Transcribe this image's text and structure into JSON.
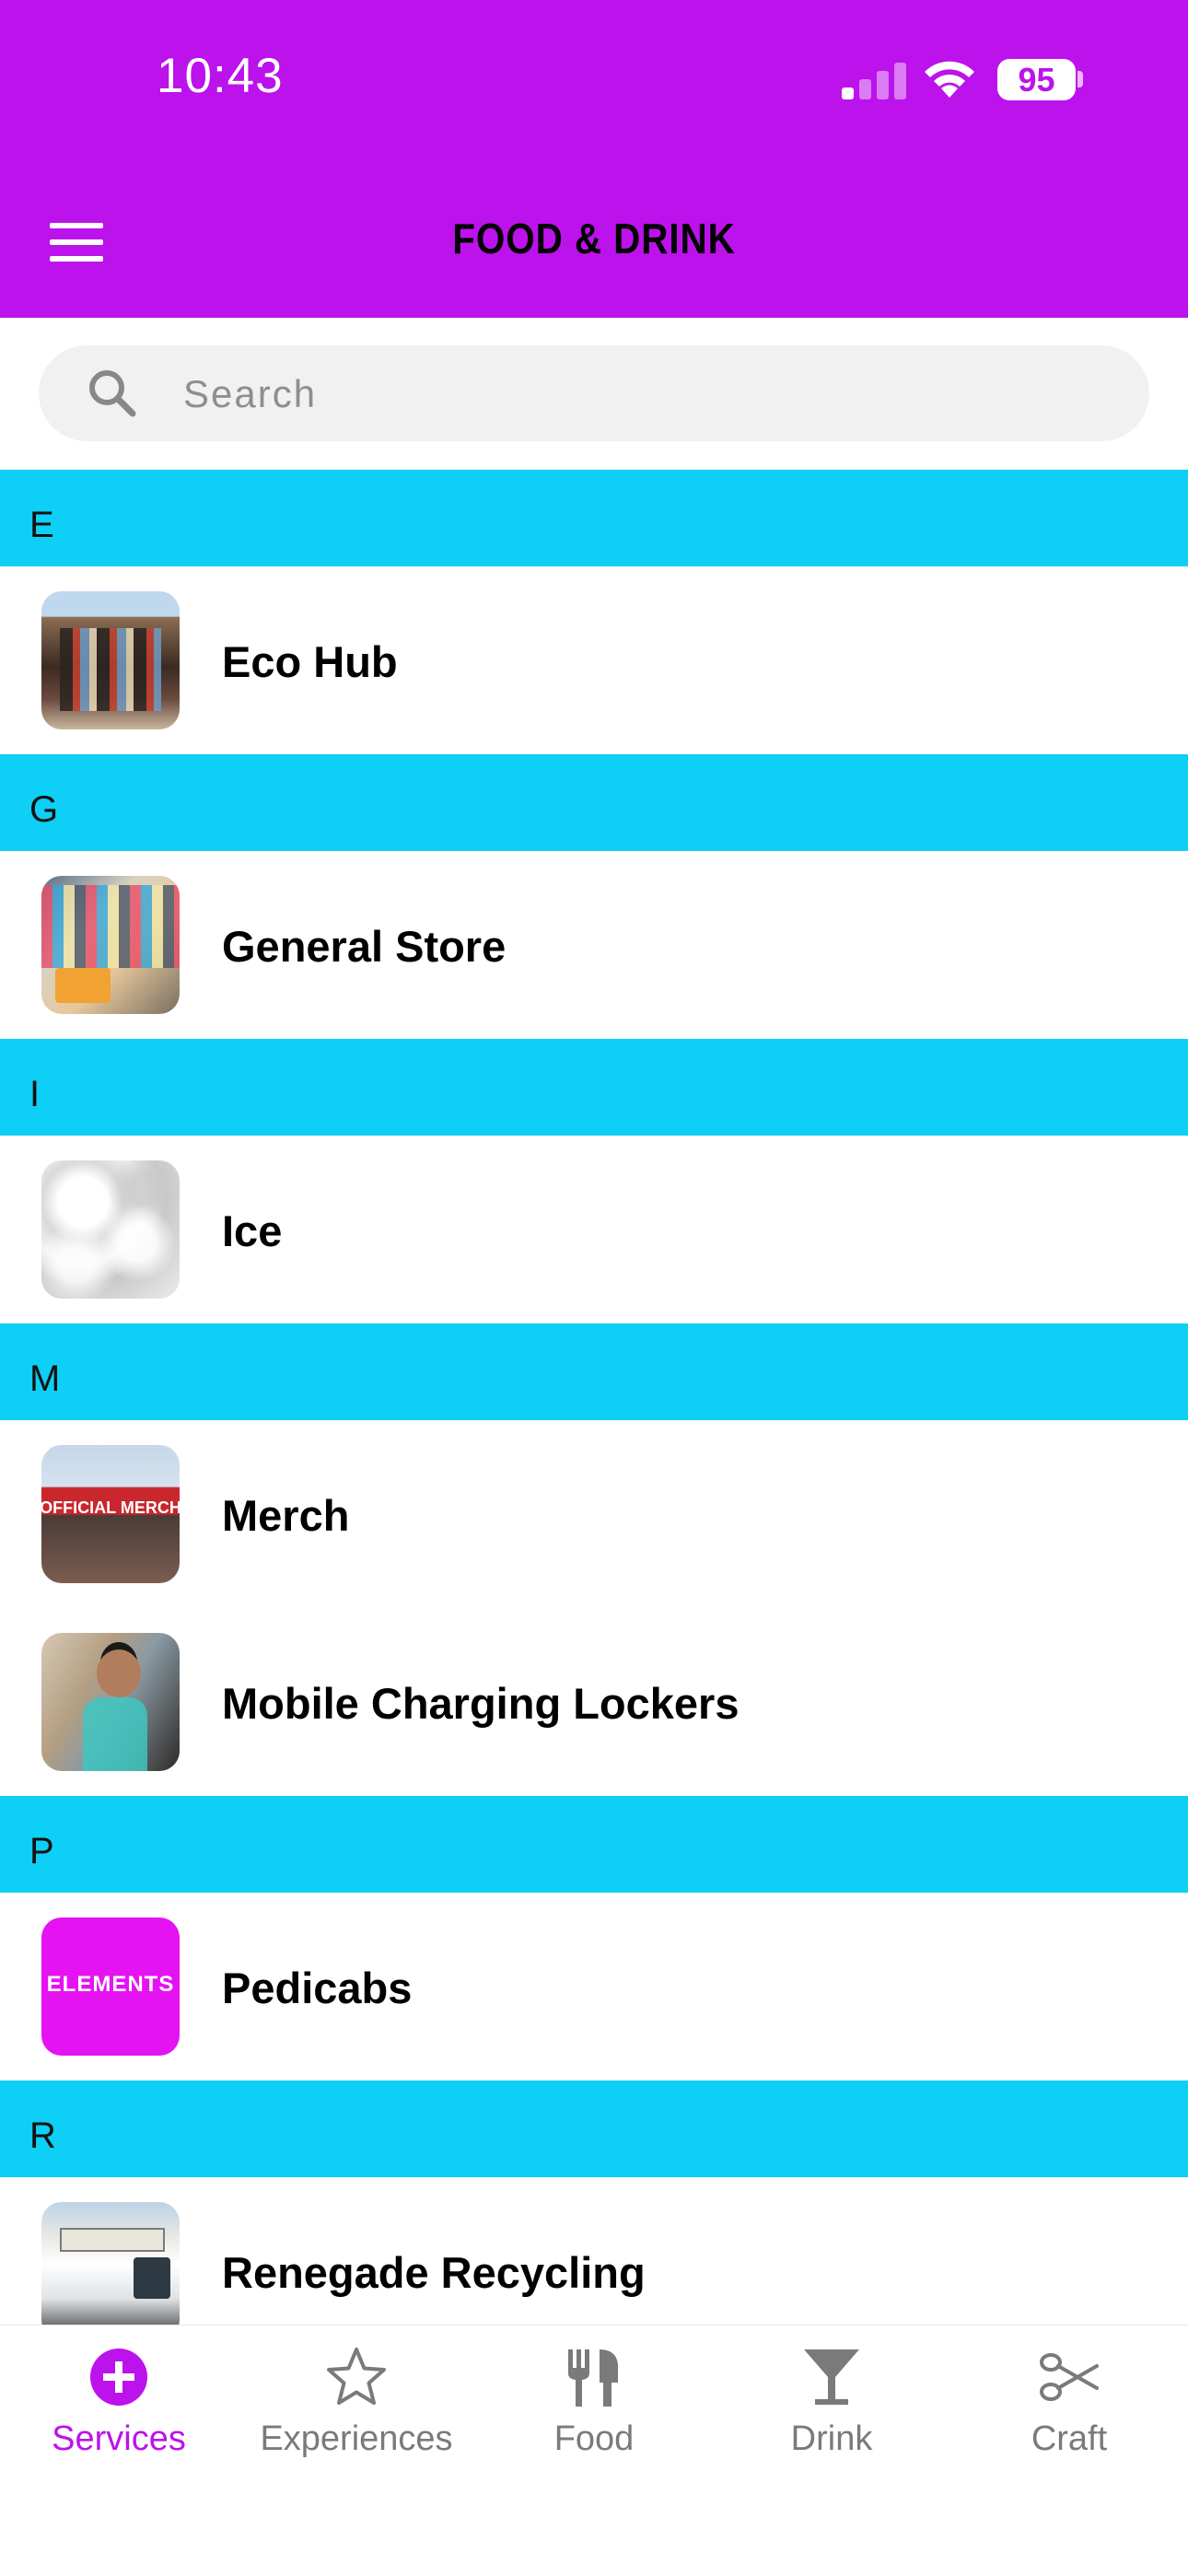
{
  "status_bar": {
    "time": "10:43",
    "battery": "95",
    "signal_bars_on": 1,
    "signal_bars_total": 4
  },
  "header": {
    "title": "FOOD & DRINK",
    "background_color": "#bc12ec",
    "menu_icon": "hamburger-menu-icon"
  },
  "search": {
    "placeholder": "Search",
    "value": "",
    "icon": "search-icon"
  },
  "sections": [
    {
      "letter": "E",
      "items": [
        {
          "label": "Eco Hub"
        }
      ]
    },
    {
      "letter": "G",
      "items": [
        {
          "label": "General Store"
        }
      ]
    },
    {
      "letter": "I",
      "items": [
        {
          "label": "Ice"
        }
      ]
    },
    {
      "letter": "M",
      "items": [
        {
          "label": "Merch",
          "thumb_text": "OFFICIAL MERCH"
        },
        {
          "label": "Mobile Charging Lockers"
        }
      ]
    },
    {
      "letter": "P",
      "items": [
        {
          "label": "Pedicabs",
          "thumb_text": "ELEMENTS"
        }
      ]
    },
    {
      "letter": "R",
      "items": [
        {
          "label": "Renegade Recycling"
        }
      ]
    }
  ],
  "section_header_color": "#0ecff5",
  "tabs": [
    {
      "label": "Services",
      "icon": "plus-circle-icon",
      "active": true
    },
    {
      "label": "Experiences",
      "icon": "star-icon",
      "active": false
    },
    {
      "label": "Food",
      "icon": "fork-knife-icon",
      "active": false
    },
    {
      "label": "Drink",
      "icon": "cocktail-glass-icon",
      "active": false
    },
    {
      "label": "Craft",
      "icon": "scissors-icon",
      "active": false
    }
  ],
  "accent_color": "#bc12ec",
  "inactive_tab_color": "#7a7a7a"
}
